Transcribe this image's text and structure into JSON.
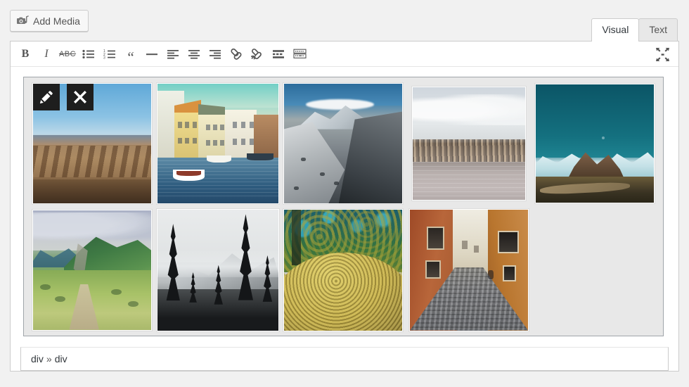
{
  "toolbar_top": {
    "add_media_label": "Add Media",
    "add_media_icon": "camera-music-icon",
    "tabs": [
      {
        "label": "Visual",
        "active": true
      },
      {
        "label": "Text",
        "active": false
      }
    ]
  },
  "format_toolbar": {
    "buttons": [
      {
        "name": "bold",
        "label": "B",
        "icon": "bold-icon",
        "title": "Bold"
      },
      {
        "name": "italic",
        "label": "I",
        "icon": "italic-icon",
        "title": "Italic"
      },
      {
        "name": "strikethrough",
        "label": "ABC",
        "icon": "strikethrough-icon",
        "title": "Strikethrough"
      },
      {
        "name": "bulleted-list",
        "label": "",
        "icon": "bulleted-list-icon",
        "title": "Bulleted list"
      },
      {
        "name": "numbered-list",
        "label": "",
        "icon": "numbered-list-icon",
        "title": "Numbered list"
      },
      {
        "name": "blockquote",
        "label": "“",
        "icon": "blockquote-icon",
        "title": "Blockquote"
      },
      {
        "name": "horizontal-rule",
        "label": "",
        "icon": "horizontal-rule-icon",
        "title": "Horizontal line"
      },
      {
        "name": "align-left",
        "label": "",
        "icon": "align-left-icon",
        "title": "Align left"
      },
      {
        "name": "align-center",
        "label": "",
        "icon": "align-center-icon",
        "title": "Align center"
      },
      {
        "name": "align-right",
        "label": "",
        "icon": "align-right-icon",
        "title": "Align right"
      },
      {
        "name": "insert-link",
        "label": "",
        "icon": "link-icon",
        "title": "Insert/edit link"
      },
      {
        "name": "remove-link",
        "label": "",
        "icon": "unlink-icon",
        "title": "Remove link"
      },
      {
        "name": "insert-more-tag",
        "label": "",
        "icon": "more-tag-icon",
        "title": "Insert Read More tag"
      },
      {
        "name": "toggle-toolbar",
        "label": "",
        "icon": "keyboard-icon",
        "title": "Toolbar Toggle"
      }
    ],
    "fullscreen": {
      "name": "distraction-free",
      "icon": "fullscreen-arrows-icon",
      "title": "Distraction-free writing mode"
    }
  },
  "gallery": {
    "block_name": "image-gallery-block",
    "selected_index": 0,
    "actions": [
      {
        "name": "edit-image",
        "icon": "pencil-icon",
        "title": "Edit"
      },
      {
        "name": "remove-image",
        "icon": "close-x-icon",
        "title": "Remove"
      }
    ],
    "columns": 5,
    "rows": 2,
    "images": [
      {
        "index": 1,
        "alt": "Arid badlands hills under a clear blue sky",
        "class": "p1"
      },
      {
        "index": 2,
        "alt": "Canal with yellow townhouses and moored boats in Bruges",
        "class": "p2"
      },
      {
        "index": 3,
        "alt": "Snow-dusted rocky mountain ridge with clouds",
        "class": "p3"
      },
      {
        "index": 4,
        "alt": "Rocky breakwater between pale water and overcast sky",
        "class": "p4"
      },
      {
        "index": 5,
        "alt": "Glaciated peaks beneath a deep teal sky",
        "class": "p5"
      },
      {
        "index": 6,
        "alt": "Green alpine meadow with a footpath",
        "class": "p6"
      },
      {
        "index": 7,
        "alt": "Black and white pine trees before a foggy mountain",
        "class": "p7"
      },
      {
        "index": 8,
        "alt": "Yellow mossy boulder under a leafy canopy",
        "class": "p8"
      },
      {
        "index": 9,
        "alt": "Narrow cobblestone alley with terracotta walls",
        "class": "p9"
      }
    ]
  },
  "statusbar": {
    "path": [
      "div",
      "div"
    ],
    "separator": "»",
    "full_text": "div » div"
  },
  "colors": {
    "page_background": "#f1f1f1",
    "editor_background": "#ffffff",
    "border": "#cccccc",
    "gallery_fill": "#e8e8e8",
    "gallery_border": "#a0a5aa",
    "action_button": "#1e1e1e",
    "text": "#32373c",
    "icon": "#555555"
  }
}
